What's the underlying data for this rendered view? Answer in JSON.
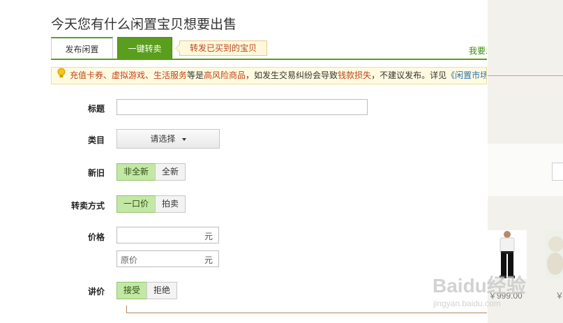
{
  "page": {
    "title": "今天您有什么闲置宝贝想要出售"
  },
  "tabs": {
    "publish_idle": "发布闲置",
    "resell": "一键转卖",
    "resell_hint": "转发已买到的宝贝",
    "want_link": "我要发"
  },
  "notice": {
    "seg1": "充值卡券、虚拟游戏、生活服务",
    "seg2": "等是",
    "seg3": "高风险商品",
    "seg4": "，如发生交易纠纷会导致",
    "seg5": "钱款损失",
    "seg6": "，不建议发布。详见",
    "seg7": "《闲置市场"
  },
  "form": {
    "title_label": "标题",
    "category_label": "类目",
    "category_select": "请选择",
    "condition_label": "新旧",
    "condition_options": [
      "非全新",
      "全新"
    ],
    "sale_mode_label": "转卖方式",
    "sale_mode_options": [
      "一口价",
      "拍卖"
    ],
    "price_label": "价格",
    "price_unit": "元",
    "original_price_placeholder": "原价",
    "original_price_unit": "元",
    "bargain_label": "讲价",
    "bargain_options": [
      "接受",
      "拒绝"
    ]
  },
  "sidebar": {
    "product_price": "￥999.00",
    "product2_price": "￥"
  },
  "watermark": {
    "text": "Baidu经验",
    "sub": "jingyan.baidu.com"
  },
  "colors": {
    "accent_green": "#5a9e1d",
    "segment_selected": "#c3e8a5",
    "warning_red": "#c0431a",
    "link_blue": "#2a6fb5"
  }
}
